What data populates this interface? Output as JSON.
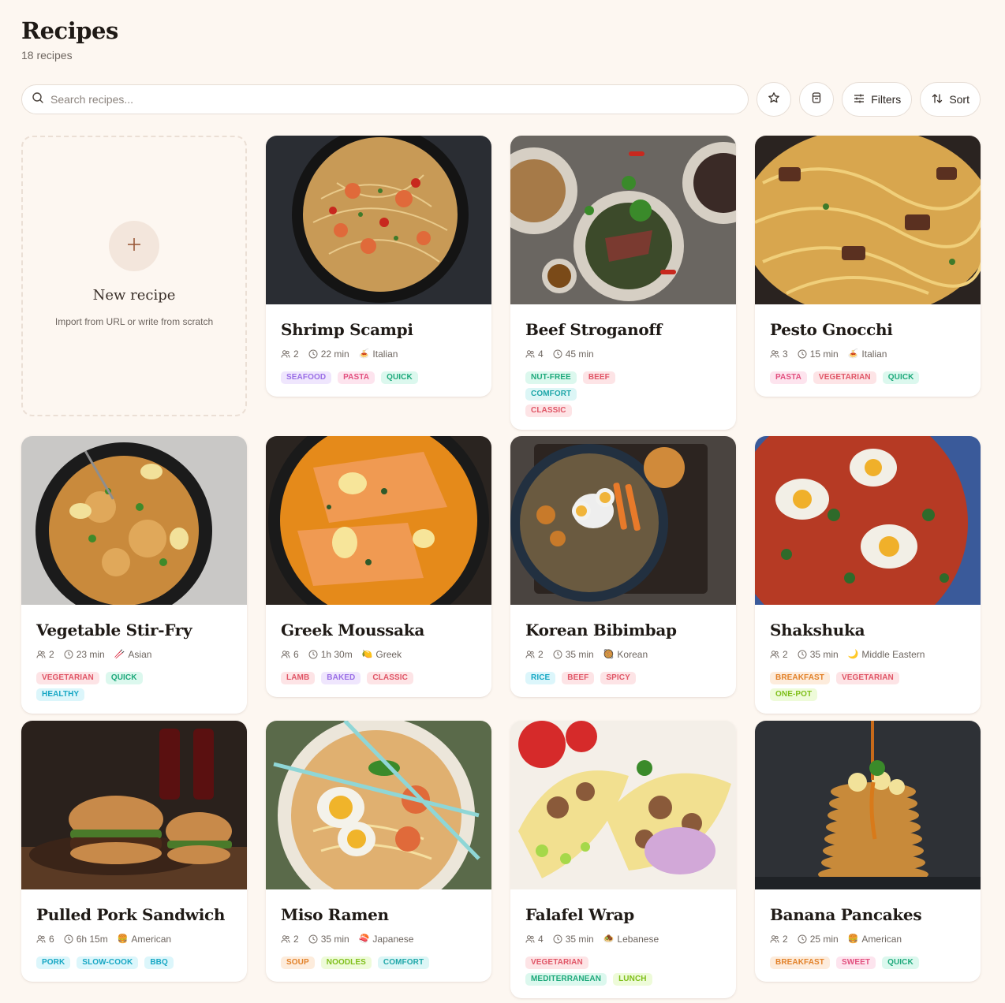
{
  "header": {
    "title": "Recipes",
    "count": "18 recipes"
  },
  "search": {
    "placeholder": "Search recipes..."
  },
  "toolbar": {
    "filters_label": "Filters",
    "sort_label": "Sort"
  },
  "new_recipe": {
    "title": "New recipe",
    "subtitle": "Import from URL or write from scratch"
  },
  "tag_colors": {
    "SEAFOOD": {
      "bg": "#efe6fd",
      "fg": "#9a6ee6"
    },
    "PASTA": {
      "bg": "#fde4ee",
      "fg": "#e2507f"
    },
    "QUICK": {
      "bg": "#dcf8ee",
      "fg": "#1ea97b"
    },
    "NUT-FREE": {
      "bg": "#dcf8ee",
      "fg": "#1ea97b"
    },
    "BEEF": {
      "bg": "#fde4e6",
      "fg": "#e05667"
    },
    "COMFORT": {
      "bg": "#dcf6f6",
      "fg": "#1fa7a9"
    },
    "CLASSIC": {
      "bg": "#fde4e6",
      "fg": "#e05667"
    },
    "VEGETARIAN": {
      "bg": "#fde4e6",
      "fg": "#e05667"
    },
    "HEALTHY": {
      "bg": "#dcf6fb",
      "fg": "#17a7c4"
    },
    "LAMB": {
      "bg": "#fde4e6",
      "fg": "#e05667"
    },
    "BAKED": {
      "bg": "#efe6fd",
      "fg": "#9a6ee6"
    },
    "RICE": {
      "bg": "#dcf6fb",
      "fg": "#17a7c4"
    },
    "SPICY": {
      "bg": "#fde4e6",
      "fg": "#e05667"
    },
    "BREAKFAST": {
      "bg": "#fdecdc",
      "fg": "#e2822a"
    },
    "ONE-POT": {
      "bg": "#eefbd9",
      "fg": "#7fbf1a"
    },
    "PORK": {
      "bg": "#dcf6fb",
      "fg": "#17a7c4"
    },
    "SLOW-COOK": {
      "bg": "#dcf6fb",
      "fg": "#17a7c4"
    },
    "BBQ": {
      "bg": "#dcf6fb",
      "fg": "#17a7c4"
    },
    "SOUP": {
      "bg": "#fdecdc",
      "fg": "#e2822a"
    },
    "NOODLES": {
      "bg": "#eefbd9",
      "fg": "#7fbf1a"
    },
    "MEDITERRANEAN": {
      "bg": "#dcf8ee",
      "fg": "#1ea97b"
    },
    "LUNCH": {
      "bg": "#eefbd9",
      "fg": "#7fbf1a"
    },
    "SWEET": {
      "bg": "#fde4ee",
      "fg": "#e2507f"
    }
  },
  "recipes": [
    {
      "title": "Shrimp Scampi",
      "servings": "2",
      "time": "22 min",
      "cuisine": "Italian",
      "cuisine_icon": "🍝",
      "tags": [
        "SEAFOOD",
        "PASTA",
        "QUICK"
      ],
      "image": "shrimp-pasta-pan-photo"
    },
    {
      "title": "Beef Stroganoff",
      "servings": "4",
      "time": "45 min",
      "cuisine": "",
      "cuisine_icon": "",
      "tags": [
        "NUT-FREE",
        "BEEF",
        "COMFORT",
        "CLASSIC"
      ],
      "image": "beef-salad-plates-photo"
    },
    {
      "title": "Pesto Gnocchi",
      "servings": "3",
      "time": "15 min",
      "cuisine": "Italian",
      "cuisine_icon": "🍝",
      "tags": [
        "PASTA",
        "VEGETARIAN",
        "QUICK"
      ],
      "image": "fettuccine-beef-photo"
    },
    {
      "title": "Vegetable Stir-Fry",
      "servings": "2",
      "time": "23 min",
      "cuisine": "Asian",
      "cuisine_icon": "🥢",
      "tags": [
        "VEGETARIAN",
        "QUICK",
        "HEALTHY"
      ],
      "image": "fried-rice-pan-photo"
    },
    {
      "title": "Greek Moussaka",
      "servings": "6",
      "time": "1h 30m",
      "cuisine": "Greek",
      "cuisine_icon": "🍋",
      "tags": [
        "LAMB",
        "BAKED",
        "CLASSIC"
      ],
      "image": "salmon-curry-photo"
    },
    {
      "title": "Korean Bibimbap",
      "servings": "2",
      "time": "35 min",
      "cuisine": "Korean",
      "cuisine_icon": "🥘",
      "tags": [
        "RICE",
        "BEEF",
        "SPICY"
      ],
      "image": "rice-bowl-eggs-photo"
    },
    {
      "title": "Shakshuka",
      "servings": "2",
      "time": "35 min",
      "cuisine": "Middle Eastern",
      "cuisine_icon": "🌙",
      "tags": [
        "BREAKFAST",
        "VEGETARIAN",
        "ONE-POT"
      ],
      "image": "eggs-tomato-pan-photo"
    },
    {
      "title": "Pulled Pork Sandwich",
      "servings": "6",
      "time": "6h 15m",
      "cuisine": "American",
      "cuisine_icon": "🍔",
      "tags": [
        "PORK",
        "SLOW-COOK",
        "BBQ"
      ],
      "image": "burgers-photo"
    },
    {
      "title": "Miso Ramen",
      "servings": "2",
      "time": "35 min",
      "cuisine": "Japanese",
      "cuisine_icon": "🍣",
      "tags": [
        "SOUP",
        "NOODLES",
        "COMFORT"
      ],
      "image": "ramen-bowl-photo"
    },
    {
      "title": "Falafel Wrap",
      "servings": "4",
      "time": "35 min",
      "cuisine": "Lebanese",
      "cuisine_icon": "🧆",
      "tags": [
        "VEGETARIAN",
        "MEDITERRANEAN",
        "LUNCH"
      ],
      "image": "meat-wrap-photo"
    },
    {
      "title": "Banana Pancakes",
      "servings": "2",
      "time": "25 min",
      "cuisine": "American",
      "cuisine_icon": "🍔",
      "tags": [
        "BREAKFAST",
        "SWEET",
        "QUICK"
      ],
      "image": "pancake-stack-photo"
    }
  ]
}
